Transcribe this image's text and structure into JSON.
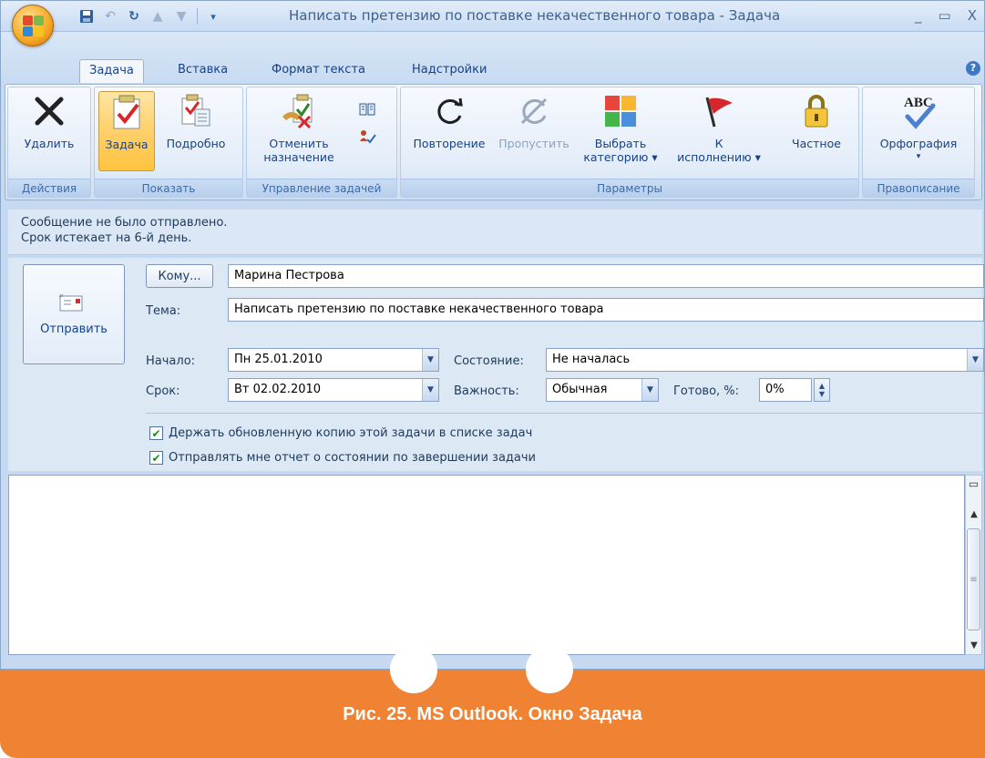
{
  "window": {
    "title": "Написать претензию по поставке некачественного товара - Задача",
    "controls": [
      "_",
      "▭",
      "X"
    ]
  },
  "tabs": [
    {
      "label": "Задача",
      "active": true
    },
    {
      "label": "Вставка",
      "active": false
    },
    {
      "label": "Формат текста",
      "active": false
    },
    {
      "label": "Надстройки",
      "active": false
    }
  ],
  "ribbon": {
    "groups": {
      "actions": "Действия",
      "show": "Показать",
      "manage": "Управление задачей",
      "params": "Параметры",
      "spelling": "Правописание"
    },
    "buttons": {
      "delete": "Удалить",
      "task": "Задача",
      "details": "Подробно",
      "cancel_assign_1": "Отменить",
      "cancel_assign_2": "назначение",
      "recurrence": "Повторение",
      "skip": "Пропустить",
      "categorize_1": "Выбрать",
      "categorize_2": "категорию ▾",
      "followup_1": "К",
      "followup_2": "исполнению ▾",
      "private": "Частное",
      "spelling": "Орфография",
      "spelling_arrow": "▾"
    }
  },
  "infobar": {
    "line1": "Сообщение не было отправлено.",
    "line2": "Срок истекает на 6-й день."
  },
  "form": {
    "send": "Отправить",
    "to_button": "Кому...",
    "to_value": "Марина Пестрова",
    "subject_label": "Тема:",
    "subject_value": "Написать претензию по поставке некачественного товара",
    "start_label": "Начало:",
    "start_value": "Пн 25.01.2010",
    "due_label": "Срок:",
    "due_value": "Вт 02.02.2010",
    "status_label": "Состояние:",
    "status_value": "Не началась",
    "priority_label": "Важность:",
    "priority_value": "Обычная",
    "complete_label": "Готово, %:",
    "complete_value": "0%",
    "keep_copy": "Держать обновленную копию этой задачи в списке задач",
    "keep_copy_checked": true,
    "send_report": "Отправлять мне отчет о состоянии по завершении задачи",
    "send_report_checked": true
  },
  "caption": "Рис. 25. MS Outlook. Окно Задача",
  "colors": {
    "accent": "#f08234",
    "ribbon_text": "#15428b",
    "window_bg": "#c5d9f1"
  }
}
